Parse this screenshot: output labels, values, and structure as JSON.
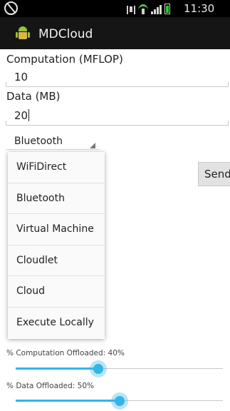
{
  "status_bar": {
    "time": "11:30 AM",
    "icons": [
      "blocked-icon",
      "vibrate-icon",
      "wifi-icon",
      "signal-icon",
      "battery-icon"
    ]
  },
  "app": {
    "title": "MDCloud",
    "icon": "android-icon"
  },
  "form": {
    "computation_label": "Computation (MFLOP)",
    "computation_value": "10",
    "data_label": "Data (MB)",
    "data_value": "20",
    "spinner_selected": "Bluetooth",
    "send_label": "Send"
  },
  "dropdown": {
    "options": [
      "WiFiDirect",
      "Bluetooth",
      "Virtual Machine",
      "Cloudlet",
      "Cloud",
      "Execute Locally"
    ]
  },
  "sliders": {
    "computation_label": "% Computation Offloaded: 40%",
    "computation_value": 40,
    "data_label": "% Data Offloaded: 50%",
    "data_value": 50
  },
  "colors": {
    "accent": "#33b5e5",
    "status_bar_bg": "#000000",
    "action_bar_bg": "#151515"
  }
}
